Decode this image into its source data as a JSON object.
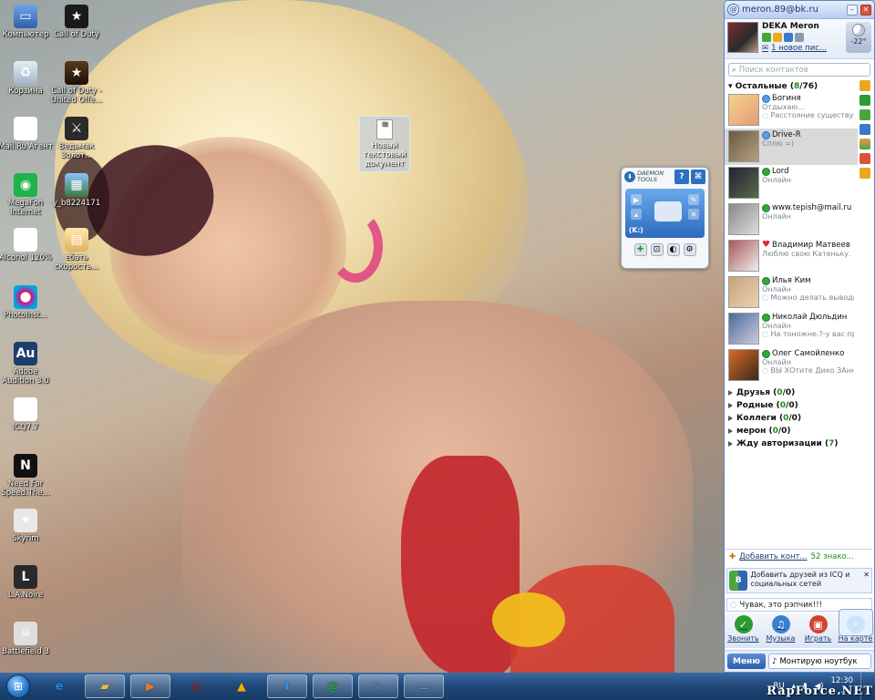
{
  "desktop": {
    "icons": [
      {
        "label": "Компьютер",
        "icon": "computer-icon",
        "glyph": "▭"
      },
      {
        "label": "Call of Duty",
        "icon": "call-of-duty-icon",
        "glyph": "★"
      },
      {
        "label": "Корзина",
        "icon": "recycle-bin-icon",
        "glyph": "♻"
      },
      {
        "label": "Call of Duty - United Offe...",
        "icon": "call-of-duty-uo-icon",
        "glyph": "★"
      },
      {
        "label": "Mail.Ru Агент",
        "icon": "mail-ru-agent-icon",
        "glyph": "@"
      },
      {
        "label": "Ведьмак Золот...",
        "icon": "witcher-icon",
        "glyph": "⚔"
      },
      {
        "label": "MegaFon Internet",
        "icon": "megafon-icon",
        "glyph": "◉"
      },
      {
        "label": "y_b8224171",
        "icon": "image-file-icon",
        "glyph": "▦"
      },
      {
        "label": "Alcohol 120%",
        "icon": "alcohol-icon",
        "glyph": "A"
      },
      {
        "label": "єбать скорость...",
        "icon": "speedtest-icon",
        "glyph": "▤"
      },
      {
        "label": "PhotoInst...",
        "icon": "photoinstrument-icon",
        "glyph": "●"
      },
      {
        "label": "Adobe Audition 3.0",
        "icon": "adobe-audition-icon",
        "glyph": "Au"
      },
      {
        "label": "ICQ7.7",
        "icon": "icq-icon",
        "glyph": "✿"
      },
      {
        "label": "Need For Speed.The...",
        "icon": "need-for-speed-icon",
        "glyph": "N"
      },
      {
        "label": "Skyrim",
        "icon": "skyrim-icon",
        "glyph": "✦"
      },
      {
        "label": "L.A.Noire",
        "icon": "la-noire-icon",
        "glyph": "L"
      },
      {
        "label": "Battlefield 3",
        "icon": "battlefield-icon",
        "glyph": "☠"
      }
    ],
    "selected_file": "Новый текстовый документ"
  },
  "daemon_tools": {
    "title": "DAEMON TOOLS",
    "help": "?",
    "rss": "⌘",
    "drive_label": "(K:)"
  },
  "agent": {
    "email": "meron.89@bk.ru",
    "profile_name": "DEKA Meron",
    "new_mail": "1 новое пис...",
    "temperature": "-22°",
    "search_placeholder": "Поиск контактов",
    "group_main": {
      "name": "Остальные",
      "open": "(",
      "online": "8",
      "sep": "/",
      "total": "76",
      "close": ")"
    },
    "contacts": [
      {
        "name": "Богиня",
        "status": "Отдыхаю...",
        "note": "Расстояние существует",
        "state": "away"
      },
      {
        "name": "Drive-R",
        "status": "Сплю =)",
        "note": "",
        "state": "away"
      },
      {
        "name": "Lord",
        "status": "Онлайн",
        "note": "",
        "state": "online"
      },
      {
        "name": "www.tepish@mail.ru",
        "status": "Онлайн",
        "note": "",
        "state": "online"
      },
      {
        "name": "Владимир Матвеев",
        "status": "Люблю свою Катеньку.",
        "note": "",
        "state": "heart"
      },
      {
        "name": "Илья Ким",
        "status": "Онлайн",
        "note": "Можно делать выводы...",
        "state": "online"
      },
      {
        "name": "Николай Дюльдин",
        "status": "Онлайн",
        "note": "На тоножне.?-у вас проб...",
        "state": "online"
      },
      {
        "name": "Олег Самойленко",
        "status": "Онлайн",
        "note": "ВЫ ХОтите Дико ЗАннет...",
        "state": "online"
      }
    ],
    "groups": [
      {
        "name": "Друзья",
        "open": "(",
        "online": "0",
        "sep": "/",
        "total": "0",
        "close": ")"
      },
      {
        "name": "Родные",
        "open": "(",
        "online": "0",
        "sep": "/",
        "total": "0",
        "close": ")"
      },
      {
        "name": "Коллеги",
        "open": "(",
        "online": "0",
        "sep": "/",
        "total": "0",
        "close": ")"
      },
      {
        "name": "мерон",
        "open": "(",
        "online": "0",
        "sep": "/",
        "total": "0",
        "close": ")"
      },
      {
        "name": "Жду авторизации",
        "open": "(",
        "online": "7",
        "sep": "",
        "total": "",
        "close": ")"
      }
    ],
    "add_contact": "Добавить конт...",
    "acquaint": "52 знако...",
    "promo_text": "Добавить друзей из ICQ и социальных сетей",
    "status_message": "Чувак, это рэпчик!!!",
    "apps": [
      {
        "label": "Звонить",
        "icon": "call-icon",
        "glyph": "✓",
        "color": "#2e9b2e"
      },
      {
        "label": "Музыка",
        "icon": "music-icon",
        "glyph": "♫",
        "color": "#3b7fd1"
      },
      {
        "label": "Играть",
        "icon": "games-icon",
        "glyph": "▣",
        "color": "#d0452e"
      },
      {
        "label": "На карте",
        "icon": "map-icon",
        "glyph": "⌖",
        "color": "#3b9fd8"
      }
    ],
    "menu_label": "Меню",
    "now_playing": "Монтирую ноутбук"
  },
  "taskbar": {
    "start_glyph": "⊞",
    "buttons": [
      {
        "icon": "ie-icon",
        "glyph": "e",
        "active": false
      },
      {
        "icon": "explorer-icon",
        "glyph": "▰",
        "active": true
      },
      {
        "icon": "media-player-icon",
        "glyph": "▶",
        "active": true
      },
      {
        "icon": "chrome-icon",
        "glyph": "◎",
        "active": false
      },
      {
        "icon": "aimp-icon",
        "glyph": "▲",
        "active": false
      },
      {
        "icon": "daemon-tools-icon",
        "glyph": "⬇",
        "active": true
      },
      {
        "icon": "mail-agent-icon",
        "glyph": "@",
        "active": true
      },
      {
        "icon": "paint-icon",
        "glyph": "✎",
        "active": true
      },
      {
        "icon": "window-icon",
        "glyph": "▭",
        "active": true
      }
    ],
    "language": "RU",
    "time": "12:30",
    "date": "..."
  },
  "watermark": "RapForce.NET"
}
